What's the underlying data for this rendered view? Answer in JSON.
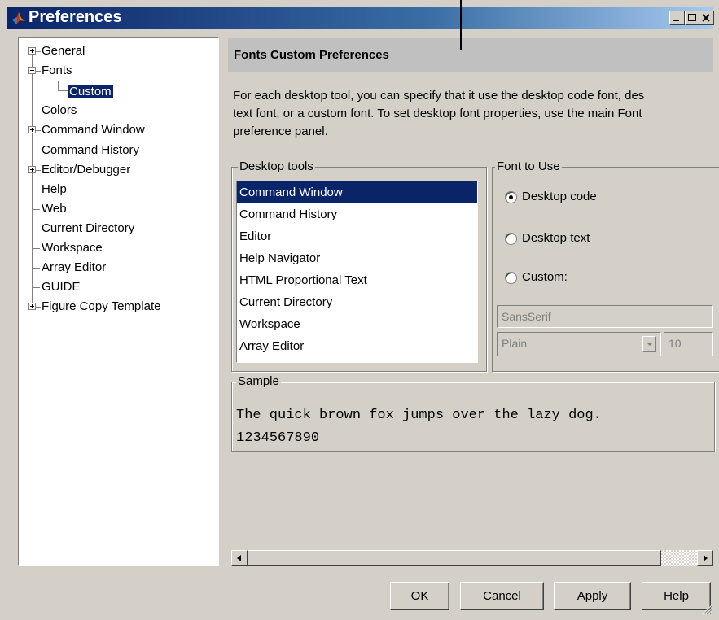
{
  "window": {
    "title": "Preferences"
  },
  "tree": {
    "items": [
      {
        "label": "General"
      },
      {
        "label": "Fonts"
      },
      {
        "label": "Custom"
      },
      {
        "label": "Colors"
      },
      {
        "label": "Command Window"
      },
      {
        "label": "Command History"
      },
      {
        "label": "Editor/Debugger"
      },
      {
        "label": "Help"
      },
      {
        "label": "Web"
      },
      {
        "label": "Current Directory"
      },
      {
        "label": "Workspace"
      },
      {
        "label": "Array Editor"
      },
      {
        "label": "GUIDE"
      },
      {
        "label": "Figure Copy Template"
      }
    ],
    "selected": "Custom"
  },
  "pane": {
    "title": "Fonts Custom Preferences",
    "description": [
      "For each desktop tool, you can specify that it use the desktop code font, des",
      "text font, or a custom font.  To set desktop font properties, use the main Font",
      "preference panel."
    ]
  },
  "desktop_tools": {
    "label": "Desktop tools",
    "items": [
      "Command Window",
      "Command History",
      "Editor",
      "Help Navigator",
      "HTML Proportional Text",
      "Current Directory",
      "Workspace",
      "Array Editor"
    ],
    "selected": "Command Window"
  },
  "font_to_use": {
    "label": "Font to Use",
    "options": [
      "Desktop code",
      "Desktop text",
      "Custom:"
    ],
    "selected": "Desktop code",
    "font_name": "SansSerif",
    "font_style": "Plain",
    "font_size": "10"
  },
  "sample": {
    "label": "Sample",
    "line1": "The quick brown fox jumps over the lazy dog.",
    "line2": "1234567890"
  },
  "buttons": {
    "ok": "OK",
    "cancel": "Cancel",
    "apply": "Apply",
    "help": "Help"
  },
  "colors": {
    "title_bar": "#0a246a",
    "selection": "#0a246a",
    "dialog_bg": "#d4d0c8",
    "header_bg": "#c0c0c0"
  }
}
